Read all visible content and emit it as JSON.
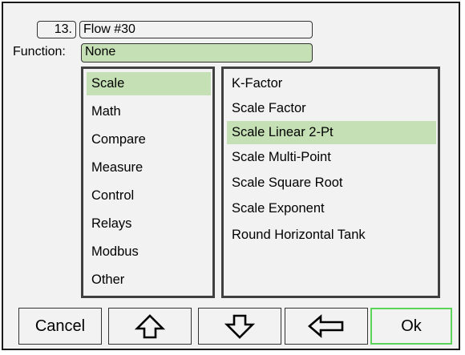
{
  "header": {
    "number": "13.",
    "name": "Flow #30"
  },
  "function": {
    "label": "Function:",
    "value": "None"
  },
  "categories": [
    "Scale",
    "Math",
    "Compare",
    "Measure",
    "Control",
    "Relays",
    "Modbus",
    "Other"
  ],
  "category_selected": "Scale",
  "subfunctions": [
    "K-Factor",
    "Scale Factor",
    "Scale Linear 2-Pt",
    "Scale Multi-Point",
    "Scale Square Root",
    "Scale Exponent",
    "Round Horizontal Tank"
  ],
  "subfunction_selected": "Scale Linear 2-Pt",
  "buttons": {
    "cancel": "Cancel",
    "up_icon": "arrow-up-icon",
    "down_icon": "arrow-down-icon",
    "back_icon": "arrow-left-icon",
    "ok": "Ok"
  },
  "colors": {
    "selection": "#c5e0b4",
    "ok_border": "#5ad55a"
  }
}
